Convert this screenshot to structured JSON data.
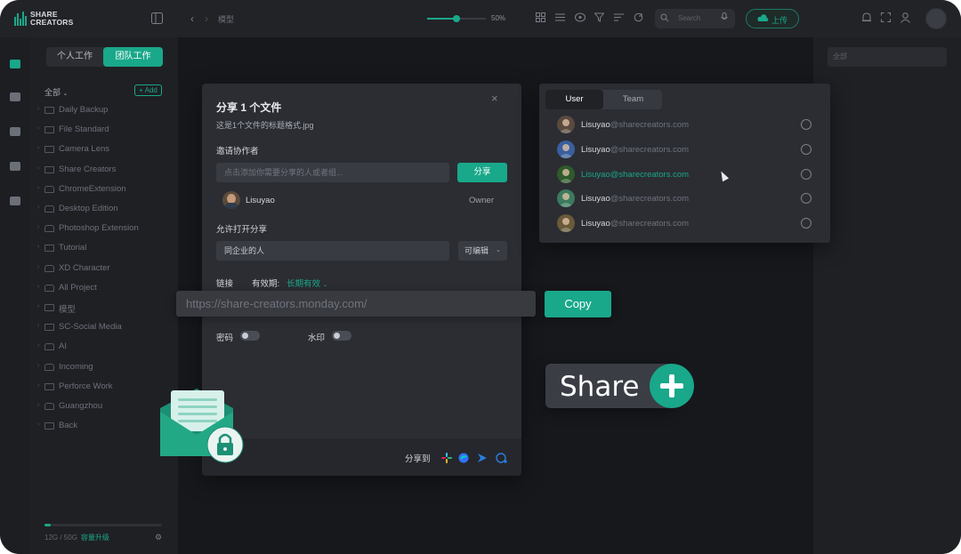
{
  "app": {
    "logo": {
      "line1": "SHARE",
      "line2": "CREATORS"
    },
    "breadcrumb": "模型",
    "zoom": {
      "label": "50%",
      "level": 0.5
    },
    "search_placeholder": "Search",
    "upload_label": "上传"
  },
  "sidebar": {
    "tabs": [
      {
        "label": "个人工作"
      },
      {
        "label": "团队工作"
      }
    ],
    "all_label": "全部",
    "add_label": "+ Add",
    "folders": [
      {
        "name": "Daily Backup",
        "lock": false
      },
      {
        "name": "File Standard",
        "lock": false
      },
      {
        "name": "Camera Lens",
        "lock": false
      },
      {
        "name": "Share Creators",
        "lock": false
      },
      {
        "name": "ChromeExtension",
        "lock": true
      },
      {
        "name": "Desktop Edition",
        "lock": true
      },
      {
        "name": "Photoshop Extension",
        "lock": true
      },
      {
        "name": "Tutorial",
        "lock": false
      },
      {
        "name": "XD Character",
        "lock": true
      },
      {
        "name": "All Project",
        "lock": true
      },
      {
        "name": "模型",
        "lock": false
      },
      {
        "name": "SC-Social Media",
        "lock": false
      },
      {
        "name": "AI",
        "lock": true
      },
      {
        "name": "Incoming",
        "lock": true
      },
      {
        "name": "Perforce Work",
        "lock": false
      },
      {
        "name": "Guangzhou",
        "lock": true
      },
      {
        "name": "Back",
        "lock": false
      }
    ],
    "storage": {
      "used_label": "12G / 50G",
      "upgrade_label": "容量升级",
      "fraction": 0.05
    }
  },
  "right_panel": {
    "filter_label": "全部"
  },
  "dialog": {
    "title": "分享 1 个文件",
    "filename": "这是1个文件的标题格式.jpg",
    "invite_label": "邀请协作者",
    "invite_placeholder": "点击添加你需要分享的人或者组...",
    "share_button": "分享",
    "collaborator": {
      "name": "Lisuyao",
      "role": "Owner"
    },
    "allow_label": "允许打开分享",
    "scope_value": "同企业的人",
    "permission_value": "可编辑",
    "link_label": "链接",
    "expiry_label": "有效期:",
    "expiry_value": "长期有效",
    "password_label": "密码",
    "watermark_label": "水印",
    "share_to_label": "分享到"
  },
  "link": {
    "url": "https://share-creators.monday.com/",
    "copy_label": "Copy"
  },
  "people_panel": {
    "tabs": [
      {
        "label": "User"
      },
      {
        "label": "Team"
      }
    ],
    "users": [
      {
        "name": "Lisuyao",
        "domain": "@sharecreators.com",
        "highlight": false
      },
      {
        "name": "Lisuyao",
        "domain": "@sharecreators.com",
        "highlight": false
      },
      {
        "name": "Lisuyao",
        "domain": "@sharecreators.com",
        "highlight": true
      },
      {
        "name": "Lisuyao",
        "domain": "@sharecreators.com",
        "highlight": false
      },
      {
        "name": "Lisuyao",
        "domain": "@sharecreators.com",
        "highlight": false
      }
    ]
  },
  "share_badge": {
    "label": "Share"
  },
  "colors": {
    "accent": "#19a88a",
    "background": "#17181c",
    "panel": "#2b2d33"
  }
}
